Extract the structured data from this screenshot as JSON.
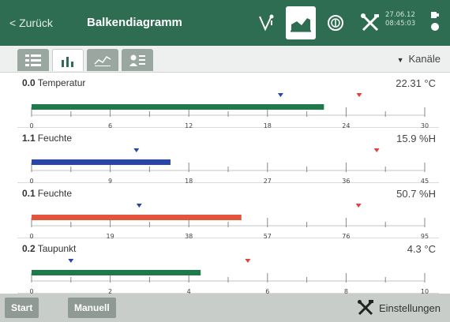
{
  "header": {
    "back_label": "< Zurück",
    "title": "Balkendiagramm",
    "time_line1": "27.06.12",
    "time_line2": "08:45:03",
    "icons": [
      "measure-icon",
      "bar-chart-icon",
      "record-icon",
      "tools-icon"
    ],
    "active_icon": "bar-chart-icon",
    "colors": {
      "background": "#2f6d52",
      "text": "#ffffff"
    }
  },
  "tabs": [
    {
      "icon": "list-view-icon",
      "active": false
    },
    {
      "icon": "bar-chart-icon",
      "active": true
    },
    {
      "icon": "line-chart-icon",
      "active": false
    },
    {
      "icon": "person-list-icon",
      "active": false
    }
  ],
  "channels_dropdown": {
    "label": "Kanäle"
  },
  "channels": [
    {
      "number": "0.0",
      "name": "Temperatur",
      "reading": "22.31 °C",
      "value": 22.31,
      "min": 0,
      "max": 30,
      "ticks": [
        "0",
        "6",
        "12",
        "18",
        "24",
        "30"
      ],
      "min_marker": 19,
      "max_marker": 25,
      "color": "#1e7a4a"
    },
    {
      "number": "1.1",
      "name": "Feuchte",
      "reading": "15.9 %H",
      "value": 15.9,
      "min": 0,
      "max": 45,
      "ticks": [
        "0",
        "9",
        "18",
        "27",
        "36",
        "45"
      ],
      "min_marker": 12,
      "max_marker": 39.5,
      "color": "#2a45a8"
    },
    {
      "number": "0.1",
      "name": "Feuchte",
      "reading": "50.7 %H",
      "value": 50.7,
      "min": 0,
      "max": 95,
      "ticks": [
        "0",
        "19",
        "38",
        "57",
        "76",
        "95"
      ],
      "min_marker": 26,
      "max_marker": 79,
      "color": "#e0553c"
    },
    {
      "number": "0.2",
      "name": "Taupunkt",
      "reading": "4.3 °C",
      "value": 4.3,
      "min": 0,
      "max": 10,
      "ticks": [
        "0",
        "2",
        "4",
        "6",
        "8",
        "10"
      ],
      "min_marker": 1,
      "max_marker": 5.5,
      "color": "#1e7a4a"
    }
  ],
  "footer": {
    "start_label": "Start",
    "second_label": "Manuell",
    "settings_label": "Einstellungen"
  }
}
